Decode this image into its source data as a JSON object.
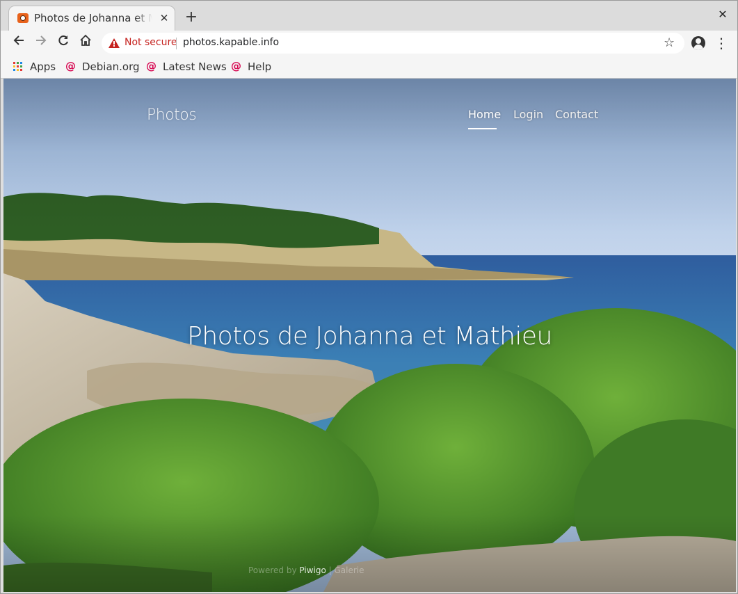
{
  "browser": {
    "tab_title": "Photos de Johanna et Mathieu",
    "tab_close": "✕",
    "new_tab": "+",
    "window_close": "✕",
    "security_label": "Not secure",
    "url": "photos.kapable.info",
    "icons": [
      "back-icon",
      "forward-icon",
      "reload-icon",
      "home-icon",
      "warning-icon",
      "star-icon",
      "profile-icon",
      "menu-icon"
    ]
  },
  "bookmarks": [
    {
      "label": "Apps",
      "icon": "apps-grid-icon"
    },
    {
      "label": "Debian.org",
      "icon": "debian-icon"
    },
    {
      "label": "Latest News",
      "icon": "debian-icon"
    },
    {
      "label": "Help",
      "icon": "debian-icon"
    }
  ],
  "site": {
    "brand": "Photos",
    "nav": [
      {
        "label": "Home",
        "active": true
      },
      {
        "label": "Login",
        "active": false
      },
      {
        "label": "Contact",
        "active": false
      }
    ],
    "hero_title": "Photos de Johanna et Mathieu",
    "footer": {
      "powered_by": "Powered by",
      "engine": "Piwigo",
      "trailing": "| Galerie"
    }
  }
}
